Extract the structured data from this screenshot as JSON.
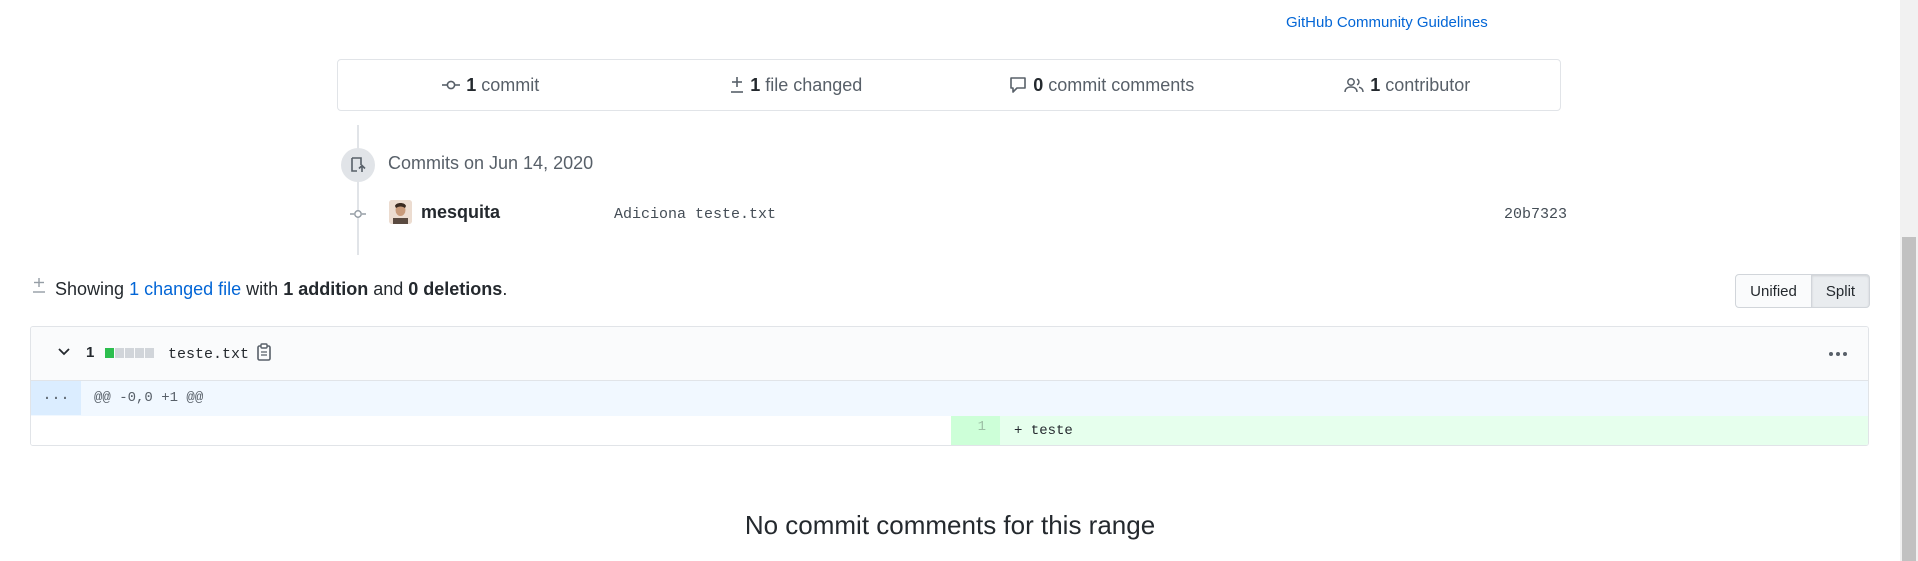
{
  "header": {
    "guidelines_link": "GitHub Community Guidelines"
  },
  "summary": {
    "commits_count": "1",
    "commits_label": "commit",
    "files_count": "1",
    "files_label": "file changed",
    "comments_count": "0",
    "comments_label": "commit comments",
    "contributors_count": "1",
    "contributors_label": "contributor"
  },
  "timeline": {
    "date_heading": "Commits on Jun 14, 2020",
    "commit": {
      "author": "mesquita",
      "message": "Adiciona teste.txt",
      "sha": "20b7323"
    }
  },
  "diff_summary": {
    "showing": "Showing",
    "changed_files_link": "1 changed file",
    "with": "with",
    "additions": "1 addition",
    "and": "and",
    "deletions": "0 deletions",
    "period": "."
  },
  "view_toggle": {
    "unified": "Unified",
    "split": "Split",
    "selected": "Split"
  },
  "file": {
    "change_count": "1",
    "diffstat_blocks": [
      "added",
      "neutral",
      "neutral",
      "neutral",
      "neutral"
    ],
    "name": "teste.txt",
    "hunk_expander": "...",
    "hunk_header": "@@ -0,0 +1 @@",
    "added_line_number": "1",
    "added_line": "+ teste"
  },
  "comments_section": {
    "empty_message": "No commit comments for this range"
  },
  "colors": {
    "link": "#0366d6",
    "addition": "#2cbe4e",
    "neutral": "#d1d5da",
    "add_bg": "#e6ffed",
    "hunk_bg": "#f1f8ff"
  }
}
